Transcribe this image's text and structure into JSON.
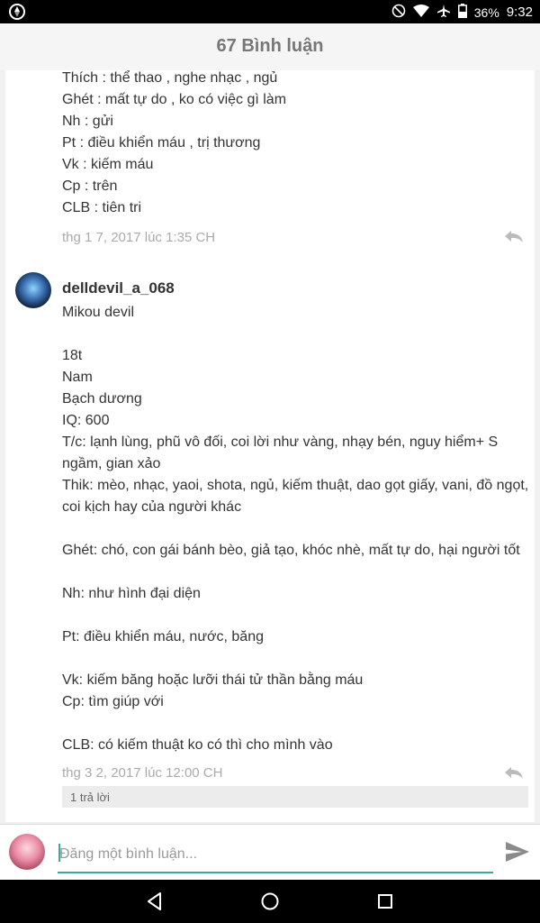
{
  "status_bar": {
    "battery_percent": "36%",
    "time": "9:32"
  },
  "header": {
    "title": "67 Bình luận"
  },
  "comments": [
    {
      "lines": [
        "Thích : thể thao , nghe nhạc , ngủ",
        "Ghét : mất tự do , ko có việc gì làm",
        "Nh : gửi",
        "Pt : điều khiển máu , trị thương",
        "Vk : kiếm máu",
        "Cp : trên",
        "CLB : tiên tri"
      ],
      "timestamp": "thg 1 7, 2017 lúc 1:35 CH"
    },
    {
      "username": "delldevil_a_068",
      "lines": [
        "Mikou devil",
        "",
        "18t",
        "Nam",
        "Bạch dương",
        "IQ: 600",
        "T/c: lạnh lùng, phũ vô đối, coi lời như vàng, nhạy bén, nguy hiểm+ S",
        "ngầm, gian xảo",
        "Thik: mèo, nhạc, yaoi, shota, ngủ, kiếm thuật, dao gọt giấy, vani, đồ ngọt,",
        "coi kịch hay của người khác",
        "",
        "Ghét: chó, con gái bánh bèo, giả tạo, khóc nhè, mất tự do, hại người tốt",
        "",
        "Nh: như hình đại diện",
        "",
        "Pt: điều khiển máu, nước, băng",
        "",
        "Vk: kiếm băng hoặc lưỡi thái tử thần bằng máu",
        "Cp: tìm giúp với",
        "",
        "CLB: có kiếm thuật ko có thì cho mình vào"
      ],
      "timestamp": "thg 3 2, 2017 lúc 12:00 CH",
      "replies_label": "1 trả lời"
    }
  ],
  "composer": {
    "placeholder": "Đăng một bình luận..."
  },
  "colors": {
    "accent": "#3aa8a0",
    "header_bg": "#f5f5f5",
    "content_bg": "#f0f0f0"
  }
}
